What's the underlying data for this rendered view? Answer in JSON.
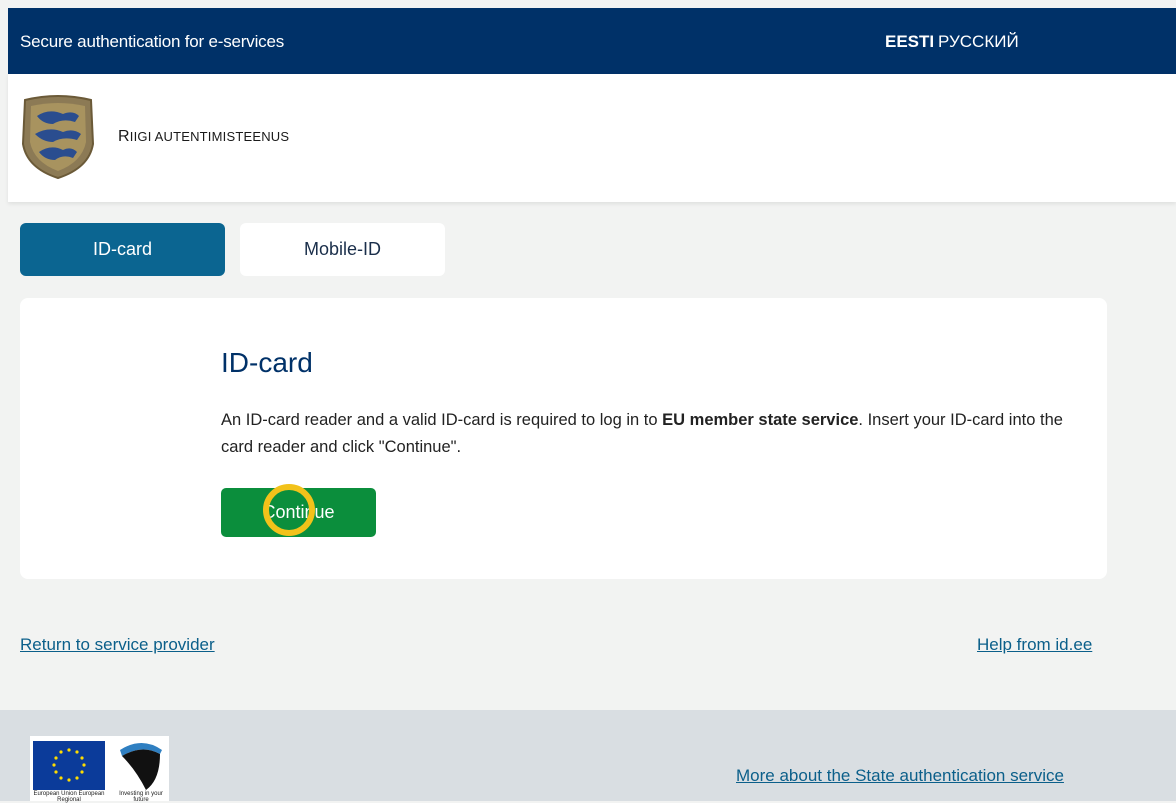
{
  "header": {
    "title": "Secure authentication for e-services",
    "lang_et": "EESTI",
    "lang_ru": "РУССКИЙ"
  },
  "brand": {
    "name_first": "R",
    "name_rest": "IIGI AUTENTIMISTEENUS"
  },
  "tabs": [
    {
      "label": "ID-card",
      "active": true
    },
    {
      "label": "Mobile-ID",
      "active": false
    }
  ],
  "card": {
    "heading": "ID-card",
    "desc_before": "An ID-card reader and a valid ID-card is required to log in to ",
    "desc_bold": "EU member state service",
    "desc_after": ". Insert your ID-card into the card reader and click \"Continue\".",
    "button": "Continue"
  },
  "links": {
    "return": "Return to service provider",
    "help": "Help from id.ee"
  },
  "footer": {
    "eu_caption": "European Union European Regional",
    "ee_caption": "Investing in your future",
    "more": "More about the State authentication service"
  },
  "colors": {
    "header_bg": "#003168",
    "tab_active": "#0b6591",
    "button": "#0b8e3c",
    "link": "#0b5f8a",
    "cursor_ring": "#f2c21a"
  }
}
